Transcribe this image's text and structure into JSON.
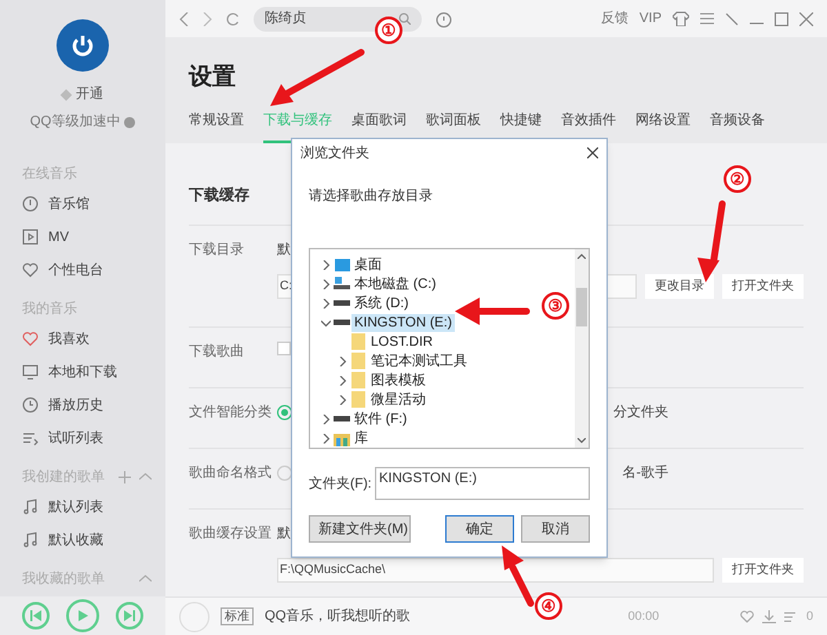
{
  "sidebar": {
    "account": {
      "open_label": "开通",
      "level_label": "QQ等级加速中"
    },
    "sections": [
      {
        "title": "在线音乐",
        "items": [
          {
            "label": "音乐馆"
          },
          {
            "label": "MV"
          },
          {
            "label": "个性电台"
          }
        ]
      },
      {
        "title": "我的音乐",
        "items": [
          {
            "label": "我喜欢"
          },
          {
            "label": "本地和下载"
          },
          {
            "label": "播放历史"
          },
          {
            "label": "试听列表"
          }
        ]
      },
      {
        "title": "我创建的歌单",
        "items": [
          {
            "label": "默认列表"
          },
          {
            "label": "默认收藏"
          }
        ]
      },
      {
        "title": "我收藏的歌单"
      }
    ]
  },
  "topbar": {
    "search_value": "陈绮贞",
    "links": [
      "反馈",
      "VIP"
    ]
  },
  "page": {
    "title": "设置",
    "tabs": [
      {
        "label": "常规设置",
        "selected": false
      },
      {
        "label": "下载与缓存",
        "selected": true
      },
      {
        "label": "桌面歌词",
        "selected": false
      },
      {
        "label": "歌词面板",
        "selected": false
      },
      {
        "label": "快捷键",
        "selected": false
      },
      {
        "label": "音效插件",
        "selected": false
      },
      {
        "label": "网络设置",
        "selected": false
      },
      {
        "label": "音频设备",
        "selected": false
      }
    ],
    "section_title": "下载缓存",
    "rows": [
      {
        "kind": "path",
        "label": "下载目录",
        "prefix": "默",
        "path": "C:",
        "buttons": [
          "更改目录",
          "打开文件夹"
        ]
      },
      {
        "kind": "checkbox",
        "label": "下载歌曲",
        "checked": false
      },
      {
        "kind": "radio",
        "label": "文件智能分类",
        "checked": true,
        "trailing": "分文件夹"
      },
      {
        "kind": "radio",
        "label": "歌曲命名格式",
        "checked": false,
        "trailing": "名-歌手"
      },
      {
        "kind": "path",
        "label": "歌曲缓存设置",
        "prefix": "默",
        "path": "F:\\QQMusicCache\\",
        "buttons": [
          "打开文件夹"
        ]
      }
    ]
  },
  "player": {
    "quality": "标准",
    "song": "QQ音乐，听我想听的歌",
    "time": "00:00",
    "count": "0"
  },
  "dialog": {
    "title": "浏览文件夹",
    "prompt": "请选择歌曲存放目录",
    "tree": [
      {
        "label": "桌面",
        "kind": "desktop",
        "expanded": false,
        "selected": false
      },
      {
        "label": "本地磁盘 (C:)",
        "kind": "system-drive",
        "expanded": false,
        "selected": false
      },
      {
        "label": "系统 (D:)",
        "kind": "drive",
        "expanded": false,
        "selected": false
      },
      {
        "label": "KINGSTON (E:)",
        "kind": "drive",
        "expanded": true,
        "selected": true,
        "children": [
          {
            "label": "LOST.DIR",
            "kind": "folder",
            "selected": false
          },
          {
            "label": "笔记本测试工具",
            "kind": "folder",
            "expanded": false,
            "selected": false
          },
          {
            "label": "图表模板",
            "kind": "folder",
            "expanded": false,
            "selected": false
          },
          {
            "label": "微星活动",
            "kind": "folder",
            "expanded": false,
            "selected": false
          }
        ]
      },
      {
        "label": "软件 (F:)",
        "kind": "drive",
        "expanded": false,
        "selected": false
      },
      {
        "label": "库",
        "kind": "library",
        "expanded": false,
        "selected": false
      }
    ],
    "folder_label": "文件夹(F):",
    "folder_value": "KINGSTON (E:)",
    "buttons": [
      {
        "label": "新建文件夹(M)",
        "default": false
      },
      {
        "label": "确定",
        "default": true
      },
      {
        "label": "取消",
        "default": false
      }
    ]
  },
  "annotations": [
    "①",
    "②",
    "③",
    "④"
  ]
}
